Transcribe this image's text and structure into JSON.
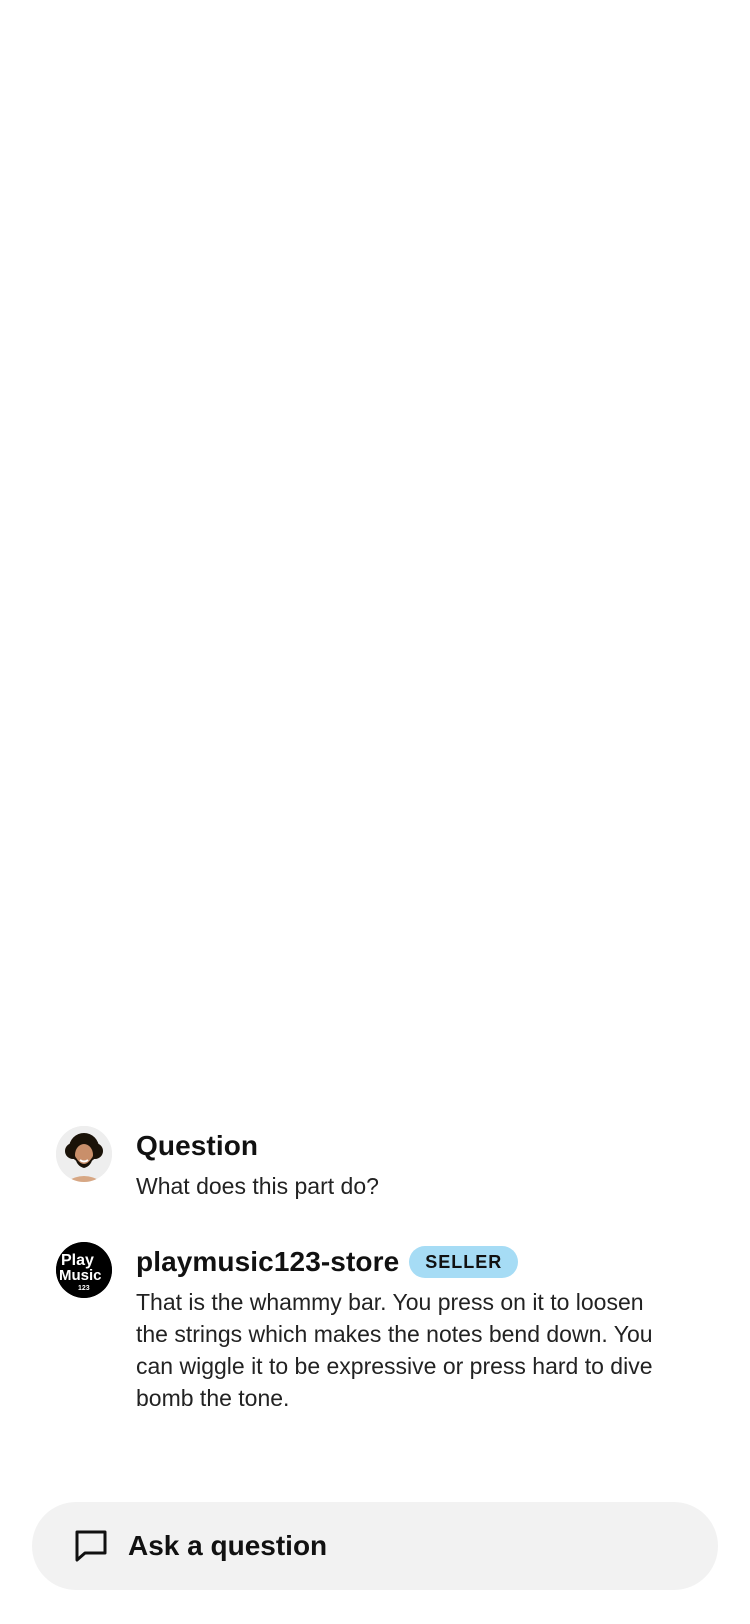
{
  "question": {
    "label": "Question",
    "text": "What does this part do?"
  },
  "answer": {
    "author": "playmusic123-store",
    "badge": "SELLER",
    "text": "That is the whammy bar. You press on it to loosen the strings which makes the notes bend down. You can wiggle it to be expressive or press hard to dive bomb the tone.",
    "logo_text": {
      "line1": "Play",
      "line2": "Music",
      "line3": "123"
    }
  },
  "ask_button": {
    "label": "Ask a question",
    "icon": "chat-bubble-icon"
  },
  "colors": {
    "badge_bg": "#a6dcf5",
    "button_bg": "#f2f2f2",
    "text": "#111111"
  }
}
